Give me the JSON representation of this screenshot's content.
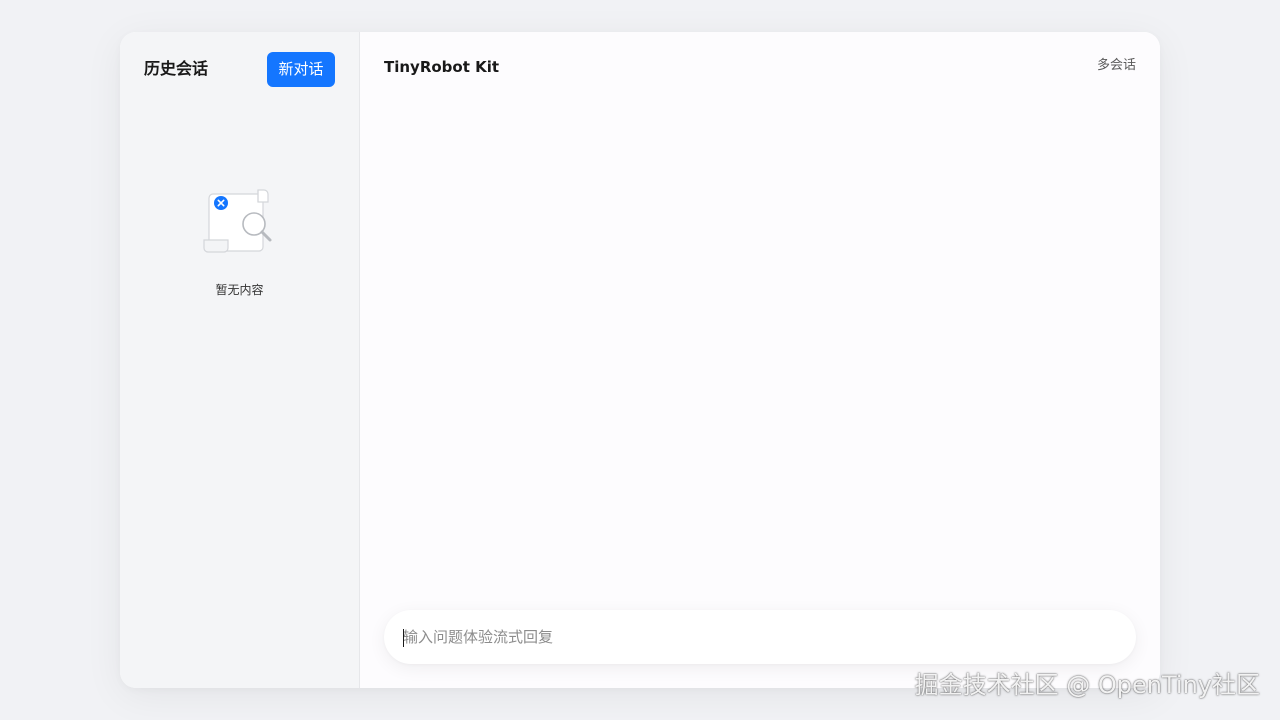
{
  "sidebar": {
    "title": "历史会话",
    "new_chat_label": "新对话",
    "empty_text": "暂无内容",
    "empty_icon": "empty-document-search-icon"
  },
  "main": {
    "title": "TinyRobot Kit",
    "multi_session_label": "多会话"
  },
  "chat_input": {
    "value": "",
    "placeholder": "输入问题体验流式回复"
  },
  "watermark": {
    "text": "掘金技术社区 @ OpenTiny社区"
  },
  "colors": {
    "accent": "#1476ff",
    "sidebar_bg": "#f4f5f7",
    "page_bg": "#f1f2f5"
  }
}
